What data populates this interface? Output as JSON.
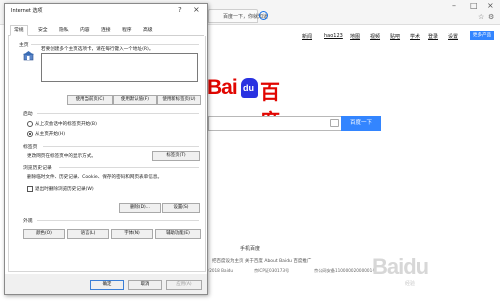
{
  "browser": {
    "tabs": [
      {
        "label": "百度一下，你就知道"
      }
    ],
    "address_value": "",
    "nav_links": [
      "新闻",
      "hao123",
      "地图",
      "视频",
      "贴吧",
      "学术",
      "登录",
      "设置"
    ],
    "more_products": "更多产品",
    "search_button": "百度一下",
    "footer_title": "手机百度",
    "footer_links": "把百度设为主页    关于百度    About Baidu    百度推广",
    "footer_copyright": "©2018 Baidu",
    "footer_icp": "京ICP证030173号",
    "footer_police": "京公网安备11000002000001号",
    "logo_bai": "Bai",
    "logo_du": "du",
    "logo_cn": "百度",
    "watermark": "Baidu",
    "watermark_sub": "经验",
    "colors": {
      "brand_red": "#e10601",
      "brand_blue": "#2932e1",
      "button_blue": "#3385ff"
    }
  },
  "dialog": {
    "title": "Internet 选项",
    "help_icon": "?",
    "close_icon": "×",
    "tabs": [
      {
        "label": "常规",
        "active": true
      },
      {
        "label": "安全",
        "active": false
      },
      {
        "label": "隐私",
        "active": false
      },
      {
        "label": "内容",
        "active": false
      },
      {
        "label": "连接",
        "active": false
      },
      {
        "label": "程序",
        "active": false
      },
      {
        "label": "高级",
        "active": false
      }
    ],
    "homepage": {
      "section": "主页",
      "description": "若要创建多个主页选项卡，请在每行键入一个地址(R)。",
      "value": "",
      "buttons": [
        "使用当前页(C)",
        "使用默认值(F)",
        "使用新标签页(U)"
      ]
    },
    "startup": {
      "section": "启动",
      "options": [
        {
          "label": "从上次会话中的标签页开始(B)",
          "selected": false
        },
        {
          "label": "从主页开始(H)",
          "selected": true
        }
      ]
    },
    "tabs_section": {
      "section": "标签页",
      "description": "更改网页在标签页中的显示方式。",
      "button": "标签页(T)"
    },
    "history": {
      "section": "浏览历史记录",
      "description": "删除临时文件、历史记录、Cookie、保存的密码和网页表单信息。",
      "checkbox": "退出时删除浏览历史记录(W)",
      "checked": false,
      "buttons": [
        "删除(D)...",
        "设置(S)"
      ]
    },
    "appearance": {
      "section": "外观",
      "buttons": [
        "颜色(O)",
        "语言(L)",
        "字体(N)",
        "辅助功能(E)"
      ]
    },
    "footer_buttons": [
      "确定",
      "取消",
      "应用(A)"
    ]
  }
}
